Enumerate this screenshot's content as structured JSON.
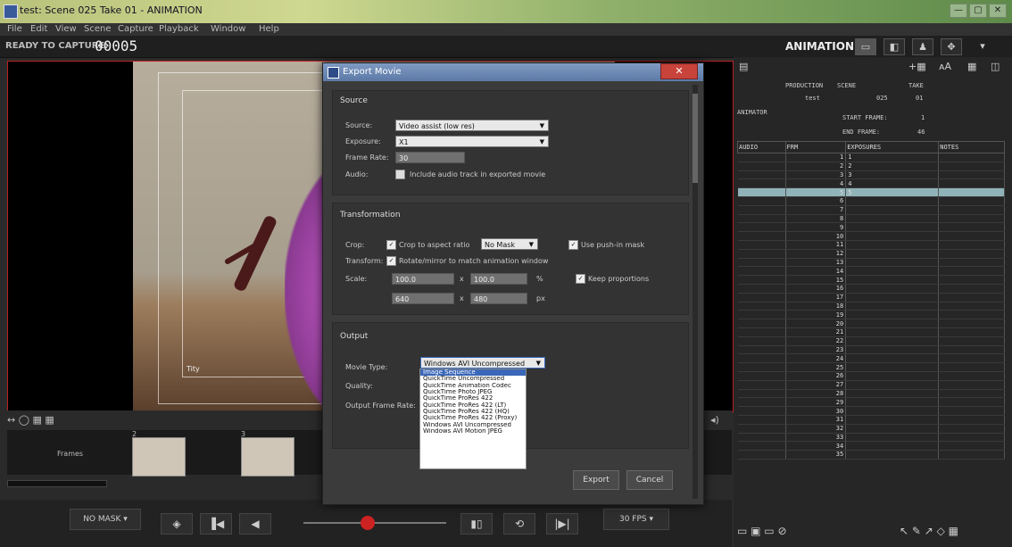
{
  "window": {
    "title": "test: Scene 025  Take 01 - ANIMATION",
    "controls": [
      "—",
      "▢",
      "✕"
    ]
  },
  "menu": [
    "File",
    "Edit",
    "View",
    "Scene",
    "Capture",
    "Playback",
    "Window",
    "Help"
  ],
  "status": {
    "ready_label": "READY TO CAPTURE:",
    "frame_number": "00005",
    "mode_label": "ANIMATION"
  },
  "viewport": {
    "frame_text": "Tity"
  },
  "timeline": {
    "label": "Frames",
    "markers": [
      "2",
      "3"
    ]
  },
  "controls": {
    "mask_button": "NO MASK ▾",
    "fps": "30 FPS ▾"
  },
  "xsheet": {
    "headers": {
      "production": "PRODUCTION",
      "scene": "SCENE",
      "take": "TAKE",
      "animator": "ANIMATOR",
      "start_frame": "START FRAME:",
      "end_frame": "END FRAME:"
    },
    "values": {
      "production": "test",
      "scene": "025",
      "take": "01",
      "start_frame": "1",
      "end_frame": "46"
    },
    "columns": [
      "AUDIO",
      "FRM",
      "EXPOSURES",
      "NOTES"
    ],
    "rows": [
      {
        "num": "1",
        "exp": "1"
      },
      {
        "num": "2",
        "exp": "2"
      },
      {
        "num": "3",
        "exp": "3"
      },
      {
        "num": "4",
        "exp": "4"
      },
      {
        "num": "5",
        "exp": "5"
      },
      {
        "num": "6",
        "exp": ""
      },
      {
        "num": "7",
        "exp": ""
      },
      {
        "num": "8",
        "exp": ""
      },
      {
        "num": "9",
        "exp": ""
      },
      {
        "num": "10",
        "exp": ""
      },
      {
        "num": "11",
        "exp": ""
      },
      {
        "num": "12",
        "exp": ""
      },
      {
        "num": "13",
        "exp": ""
      },
      {
        "num": "14",
        "exp": ""
      },
      {
        "num": "15",
        "exp": ""
      },
      {
        "num": "16",
        "exp": ""
      },
      {
        "num": "17",
        "exp": ""
      },
      {
        "num": "18",
        "exp": ""
      },
      {
        "num": "19",
        "exp": ""
      },
      {
        "num": "20",
        "exp": ""
      },
      {
        "num": "21",
        "exp": ""
      },
      {
        "num": "22",
        "exp": ""
      },
      {
        "num": "23",
        "exp": ""
      },
      {
        "num": "24",
        "exp": ""
      },
      {
        "num": "25",
        "exp": ""
      },
      {
        "num": "26",
        "exp": ""
      },
      {
        "num": "27",
        "exp": ""
      },
      {
        "num": "28",
        "exp": ""
      },
      {
        "num": "29",
        "exp": ""
      },
      {
        "num": "30",
        "exp": ""
      },
      {
        "num": "31",
        "exp": ""
      },
      {
        "num": "32",
        "exp": ""
      },
      {
        "num": "33",
        "exp": ""
      },
      {
        "num": "34",
        "exp": ""
      },
      {
        "num": "35",
        "exp": ""
      }
    ],
    "highlight_row": 5
  },
  "dialog": {
    "title": "Export Movie",
    "source": {
      "header": "Source",
      "source_label": "Source:",
      "source_value": "Video assist (low res)",
      "exposure_label": "Exposure:",
      "exposure_value": "X1",
      "framerate_label": "Frame Rate:",
      "framerate_value": "30",
      "audio_label": "Audio:",
      "audio_text": "Include audio track in exported movie"
    },
    "transformation": {
      "header": "Transformation",
      "crop_label": "Crop:",
      "crop_text": "Crop to aspect ratio",
      "mask_value": "No Mask",
      "pushin_text": "Use push-in mask",
      "transform_label": "Transform:",
      "transform_text": "Rotate/mirror to match animation window",
      "scale_label": "Scale:",
      "scale_w": "100.0",
      "scale_h": "100.0",
      "scale_unit": "%",
      "times": "x",
      "keep_text": "Keep proportions",
      "px_w": "640",
      "px_h": "480",
      "px_unit": "px"
    },
    "output": {
      "header": "Output",
      "movietype_label": "Movie Type:",
      "movietype_value": "Windows AVI Uncompressed",
      "quality_label": "Quality:",
      "outframerate_label": "Output Frame Rate:",
      "options": [
        "Image Sequence",
        "QuickTime Uncompressed",
        "QuickTime Animation Codec",
        "QuickTime Photo JPEG",
        "QuickTime ProRes 422",
        "QuickTime ProRes 422 (LT)",
        "QuickTime ProRes 422 (HQ)",
        "QuickTime ProRes 422 (Proxy)",
        "Windows AVI Uncompressed",
        "Windows AVI Motion JPEG"
      ]
    },
    "buttons": {
      "export": "Export",
      "cancel": "Cancel"
    }
  }
}
